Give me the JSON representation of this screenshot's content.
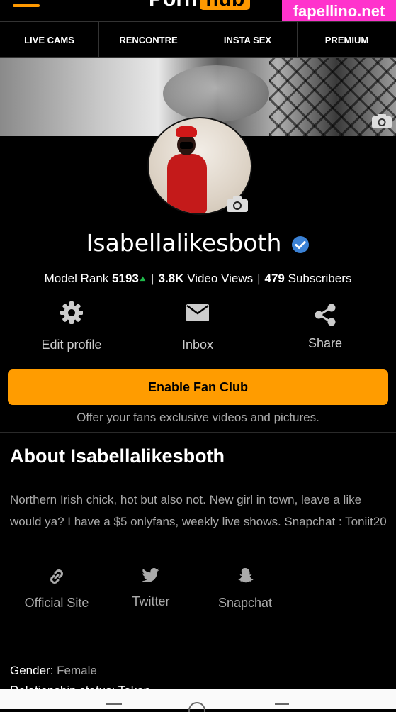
{
  "header": {
    "logo_left": "Porn",
    "logo_right": "hub"
  },
  "watermark": "fapellino.net",
  "nav": [
    {
      "label": "LIVE CAMS"
    },
    {
      "label": "RENCONTRE"
    },
    {
      "label": "INSTA SEX"
    },
    {
      "label": "PREMIUM"
    }
  ],
  "profile": {
    "username": "Isabellalikesboth",
    "verified": true,
    "stats": {
      "rank_label": "Model Rank",
      "rank_value": "5193",
      "views_value": "3.8K",
      "views_label": "Video Views",
      "subs_value": "479",
      "subs_label": "Subscribers"
    }
  },
  "actions": [
    {
      "label": "Edit profile",
      "icon": "gear-icon"
    },
    {
      "label": "Inbox",
      "icon": "envelope-icon"
    },
    {
      "label": "Share",
      "icon": "share-icon"
    }
  ],
  "fanclub": {
    "button": "Enable Fan Club",
    "subtitle": "Offer your fans exclusive videos and pictures."
  },
  "about": {
    "title": "About Isabellalikesboth",
    "bio": "Northern Irish chick, hot but also not. New girl in town, leave a like would ya? I have a $5 onlyfans, weekly live shows. Snapchat : Toniit20",
    "links": [
      {
        "label": "Official Site",
        "icon": "link-icon"
      },
      {
        "label": "Twitter",
        "icon": "twitter-icon"
      },
      {
        "label": "Snapchat",
        "icon": "snapchat-icon"
      }
    ],
    "gender_label": "Gender:",
    "gender_value": "Female",
    "relationship_partial": "Relationship status: Taken"
  },
  "colors": {
    "accent": "#ff9c00",
    "verified": "#3b82d6",
    "rank_up": "#1fb84a",
    "watermark": "#ff33cc"
  }
}
